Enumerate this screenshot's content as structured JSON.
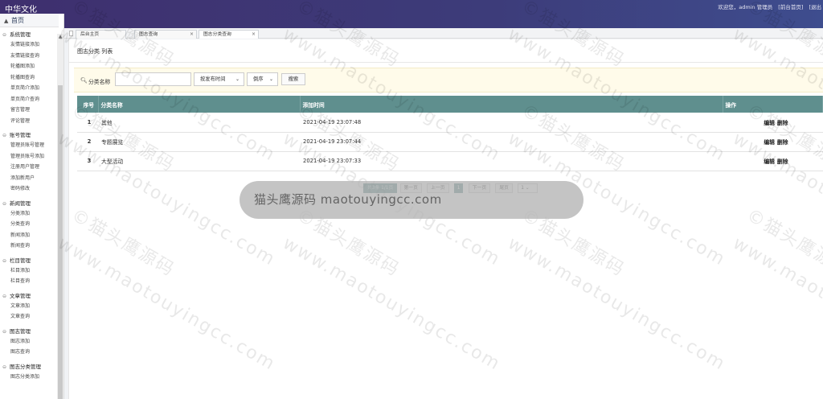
{
  "app": {
    "title": "中华文化"
  },
  "topbar": {
    "welcome": "欢迎您，admin 管理员",
    "home_link": "[前台首页]",
    "logout_link": "[退出"
  },
  "sidebar": {
    "home": "首页",
    "groups": [
      {
        "title": "系统管理",
        "items": [
          "友情链接添加",
          "友情链接查询",
          "轮播图添加",
          "轮播图查询",
          "单页简介添加",
          "单页简介查询",
          "留言管理",
          "评论管理"
        ]
      },
      {
        "title": "账号管理",
        "items": [
          "管理员账号管理",
          "管理员账号添加",
          "注册用户管理",
          "添加新用户",
          "密码修改"
        ]
      },
      {
        "title": "新闻管理",
        "items": [
          "分类添加",
          "分类查询",
          "新闻添加",
          "新闻查询"
        ]
      },
      {
        "title": "栏目管理",
        "items": [
          "栏目添加",
          "栏目查询"
        ]
      },
      {
        "title": "文章管理",
        "items": [
          "文章添加",
          "文章查询"
        ]
      },
      {
        "title": "图志管理",
        "items": [
          "图志添加",
          "图志查询"
        ]
      },
      {
        "title": "图志分类管理",
        "items": [
          "图志分类添加"
        ]
      }
    ]
  },
  "tabs": [
    {
      "label": "后台主页",
      "closable": false
    },
    {
      "label": "图志查询",
      "closable": true
    },
    {
      "label": "图志分类查询",
      "closable": true
    }
  ],
  "panel": {
    "title": "图志分类 列表"
  },
  "search": {
    "label": "分类名称",
    "value": "",
    "sort_option": "按发布时间",
    "order_option": "倒序",
    "button": "搜索"
  },
  "table": {
    "headers": [
      "序号",
      "分类名称",
      "添加时间",
      "操作"
    ],
    "rows": [
      {
        "no": "1",
        "name": "其他",
        "time": "2021-04-19 23:07:48",
        "edit": "编辑",
        "del": "删除"
      },
      {
        "no": "2",
        "name": "专题展览",
        "time": "2021-04-19 23:07:44",
        "edit": "编辑",
        "del": "删除"
      },
      {
        "no": "3",
        "name": "大型活动",
        "time": "2021-04-19 23:07:33",
        "edit": "编辑",
        "del": "删除"
      }
    ]
  },
  "pager": {
    "info": "共3条 1/1页",
    "first": "第一页",
    "prev": "上一页",
    "current": "1",
    "next": "下一页",
    "last": "尾页",
    "page_select": "1"
  },
  "watermark": {
    "overlay": "猫头鹰源码 maotouyingcc.com",
    "text_cn": "©猫头鹰源码",
    "text_en": "www.maotouyingcc.com"
  },
  "colors": {
    "topbar": "#3d3c7a",
    "table_header": "#5f8f8e",
    "search_bg": "#fffbea"
  },
  "icons": {
    "home": "home-icon",
    "search": "search-icon",
    "close": "close-icon",
    "chevron": "chevron-down-icon"
  }
}
